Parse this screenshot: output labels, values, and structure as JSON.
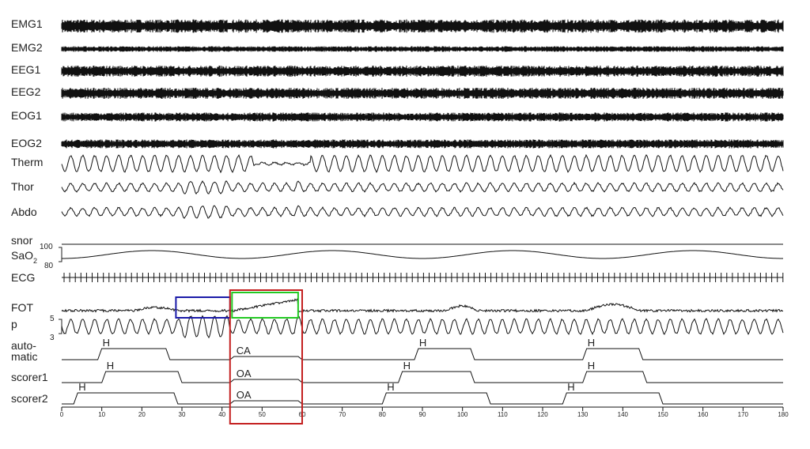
{
  "chart_data": {
    "type": "line",
    "xlim": [
      0,
      180
    ],
    "xticks": [
      "0",
      "10",
      "20",
      "30",
      "40",
      "50",
      "60",
      "70",
      "80",
      "90",
      "100",
      "110",
      "120",
      "130",
      "140",
      "150",
      "160",
      "170",
      "180"
    ],
    "channels": [
      {
        "label": "EMG1",
        "style": "dense"
      },
      {
        "label": "EMG2",
        "style": "dense"
      },
      {
        "label": "EEG1",
        "style": "dense"
      },
      {
        "label": "EEG2",
        "style": "dense"
      },
      {
        "label": "EOG1",
        "style": "dense"
      },
      {
        "label": "EOG2",
        "style": "dense"
      },
      {
        "label": "Therm",
        "style": "resp"
      },
      {
        "label": "Thor",
        "style": "resp"
      },
      {
        "label": "Abdo",
        "style": "resp"
      },
      {
        "label": "snor",
        "style": "flat"
      },
      {
        "label": "SaO",
        "subscript": "2",
        "style": "sat",
        "scale_top": "100",
        "scale_bottom": "80"
      },
      {
        "label": "ECG",
        "style": "ecg"
      },
      {
        "label": "FOT",
        "style": "fot"
      },
      {
        "label": "p",
        "style": "resp",
        "scale_top": "5",
        "scale_bottom": "3"
      }
    ],
    "apnea_spans": [
      [
        30,
        42
      ],
      [
        60,
        60
      ]
    ],
    "event_tracks": [
      {
        "label": "auto-",
        "label2": "matic",
        "events": [
          {
            "type": "H",
            "start": 9,
            "end": 27
          },
          {
            "type": "CA",
            "start": 42,
            "end": 60
          },
          {
            "type": "H",
            "start": 88,
            "end": 103
          },
          {
            "type": "H",
            "start": 130,
            "end": 145
          }
        ]
      },
      {
        "label": "scorer1",
        "events": [
          {
            "type": "H",
            "start": 10,
            "end": 30
          },
          {
            "type": "OA",
            "start": 42,
            "end": 60
          },
          {
            "type": "H",
            "start": 84,
            "end": 103
          },
          {
            "type": "H",
            "start": 130,
            "end": 146
          }
        ]
      },
      {
        "label": "scorer2",
        "events": [
          {
            "type": "H",
            "start": 3,
            "end": 29
          },
          {
            "type": "OA",
            "start": 42,
            "end": 60
          },
          {
            "type": "H",
            "start": 80,
            "end": 107
          },
          {
            "type": "H",
            "start": 125,
            "end": 150
          }
        ]
      }
    ],
    "highlights": [
      {
        "name": "blue",
        "color": "#1a1aa8",
        "x": [
          28.5,
          42
        ]
      },
      {
        "name": "green",
        "color": "#22c922",
        "x": [
          42.5,
          59
        ]
      },
      {
        "name": "red",
        "color": "#c42020",
        "x": [
          42,
          60
        ]
      }
    ]
  }
}
